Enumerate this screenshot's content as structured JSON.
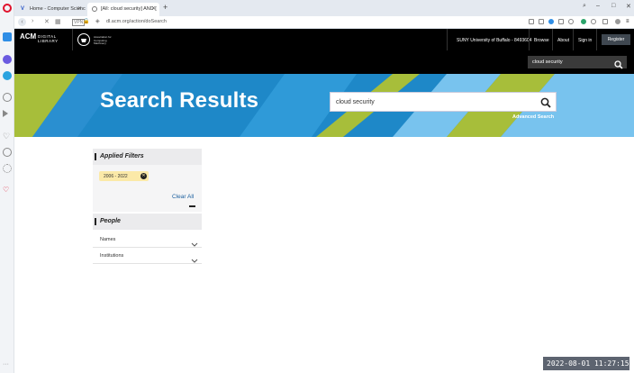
{
  "browser": {
    "tabs": [
      {
        "title": "Home - Computer Scienc",
        "favicon": "ub-favicon"
      },
      {
        "title": "[All: cloud security] AND [",
        "favicon": "acm-favicon"
      }
    ],
    "new_tab": "+",
    "url": "dl.acm.org/action/doSearch",
    "window_controls": [
      "–",
      "□",
      "✕"
    ]
  },
  "acm_header": {
    "logo_main": "ACM",
    "logo_sub_1": "DIGITAL",
    "logo_sub_2": "LIBRARY",
    "assoc_text": "Association for Computing Machinery",
    "institution": "SUNY University of Buffalo - 8493604",
    "nav": [
      "Browse",
      "About",
      "Sign in"
    ],
    "register": "Register",
    "search_value": "cloud security"
  },
  "banner": {
    "title": "Search Results",
    "search_value": "cloud security",
    "advanced_search": "Advanced Search"
  },
  "sidebar": {
    "applied_filters_heading": "Applied Filters",
    "filter_pill": "2006 - 2022",
    "clear_all": "Clear All",
    "people_heading": "People",
    "people_items": [
      "Names",
      "Institutions"
    ]
  },
  "timestamp": "2022-08-01  11:27:15",
  "colors": {
    "banner_blue": "#1e88c8",
    "banner_light_blue": "#78c3ee",
    "banner_green": "#a7be3a",
    "link_blue": "#1a5f9e",
    "pill_yellow": "#fbe9a8",
    "opera_red": "#e0112b"
  }
}
